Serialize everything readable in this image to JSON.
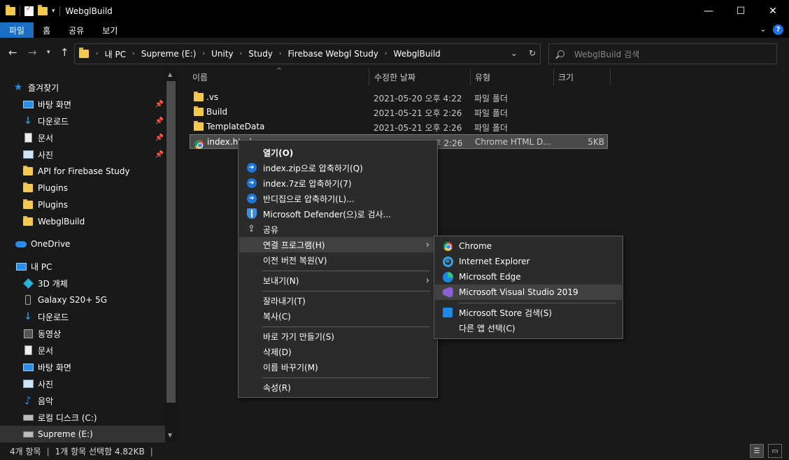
{
  "window": {
    "title": "WebglBuild",
    "minimize": "—",
    "maximize": "☐",
    "close": "✕"
  },
  "ribbon": {
    "tabs": [
      "파일",
      "홈",
      "공유",
      "보기"
    ]
  },
  "address": {
    "crumbs": [
      "내 PC",
      "Supreme (E:)",
      "Unity",
      "Study",
      "Firebase Webgl Study",
      "WebglBuild"
    ],
    "search_placeholder": "WebglBuild 검색"
  },
  "navpane": {
    "items": [
      {
        "label": "즐겨찾기",
        "icon": "star-icon",
        "pinned": false
      },
      {
        "label": "바탕 화면",
        "icon": "desktop-icon",
        "pinned": true
      },
      {
        "label": "다운로드",
        "icon": "download-icon",
        "pinned": true
      },
      {
        "label": "문서",
        "icon": "document-icon",
        "pinned": true
      },
      {
        "label": "사진",
        "icon": "pictures-icon",
        "pinned": true
      },
      {
        "label": "API for Firebase Study",
        "icon": "folder-icon",
        "pinned": false
      },
      {
        "label": "Plugins",
        "icon": "folder-icon",
        "pinned": false
      },
      {
        "label": "Plugins",
        "icon": "folder-icon",
        "pinned": false
      },
      {
        "label": "WebglBuild",
        "icon": "folder-icon",
        "pinned": false
      },
      {
        "label": "OneDrive",
        "icon": "onedrive-icon",
        "pinned": false
      },
      {
        "label": "내 PC",
        "icon": "pc-icon",
        "pinned": false
      },
      {
        "label": "3D 개체",
        "icon": "3d-objects-icon",
        "pinned": false
      },
      {
        "label": "Galaxy S20+ 5G",
        "icon": "phone-icon",
        "pinned": false
      },
      {
        "label": "다운로드",
        "icon": "download-icon",
        "pinned": false
      },
      {
        "label": "동영상",
        "icon": "video-icon",
        "pinned": false
      },
      {
        "label": "문서",
        "icon": "document-icon",
        "pinned": false
      },
      {
        "label": "바탕 화면",
        "icon": "desktop-icon",
        "pinned": false
      },
      {
        "label": "사진",
        "icon": "pictures-icon",
        "pinned": false
      },
      {
        "label": "음악",
        "icon": "music-icon",
        "pinned": false
      },
      {
        "label": "로컬 디스크 (C:)",
        "icon": "drive-icon",
        "pinned": false
      },
      {
        "label": "Supreme (E:)",
        "icon": "drive-icon",
        "pinned": false
      }
    ]
  },
  "filelist": {
    "columns": [
      "이름",
      "수정한 날짜",
      "유형",
      "크기"
    ],
    "rows": [
      {
        "name": ".vs",
        "date": "2021-05-20 오후 4:22",
        "type": "파일 폴더",
        "size": "",
        "icon": "folder-icon"
      },
      {
        "name": "Build",
        "date": "2021-05-21 오후 2:26",
        "type": "파일 폴더",
        "size": "",
        "icon": "folder-icon"
      },
      {
        "name": "TemplateData",
        "date": "2021-05-21 오후 2:26",
        "type": "파일 폴더",
        "size": "",
        "icon": "folder-icon"
      },
      {
        "name": "index.html",
        "date": "2021-05-21 오후 2:26",
        "type": "Chrome HTML D...",
        "size": "5KB",
        "icon": "chrome-icon"
      }
    ]
  },
  "context_menu": {
    "items": [
      {
        "label": "열기(O)",
        "bold": true
      },
      {
        "label": "index.zip으로 압축하기(Q)",
        "icon": "bandizip-icon"
      },
      {
        "label": "index.7z로 압축하기(7)",
        "icon": "bandizip-icon"
      },
      {
        "label": "반디집으로 압축하기(L)...",
        "icon": "bandizip-icon"
      },
      {
        "label": "Microsoft Defender(으)로 검사...",
        "icon": "defender-shield-icon"
      },
      {
        "label": "공유",
        "icon": "share-icon"
      },
      {
        "label": "연결 프로그램(H)",
        "submenu": true
      },
      {
        "label": "이전 버전 복원(V)"
      },
      {
        "label": "보내기(N)",
        "submenu": true
      },
      {
        "label": "잘라내기(T)"
      },
      {
        "label": "복사(C)"
      },
      {
        "label": "바로 가기 만들기(S)"
      },
      {
        "label": "삭제(D)"
      },
      {
        "label": "이름 바꾸기(M)"
      },
      {
        "label": "속성(R)"
      }
    ]
  },
  "open_with_menu": {
    "items": [
      {
        "label": "Chrome",
        "icon": "chrome-icon"
      },
      {
        "label": "Internet Explorer",
        "icon": "internet-explorer-icon"
      },
      {
        "label": "Microsoft Edge",
        "icon": "edge-icon"
      },
      {
        "label": "Microsoft Visual Studio 2019",
        "icon": "visual-studio-icon"
      },
      {
        "label": "Microsoft Store 검색(S)",
        "icon": "store-icon"
      },
      {
        "label": "다른 앱 선택(C)"
      }
    ]
  },
  "status": {
    "count": "4개 항목",
    "selected": "1개 항목 선택함 4.82KB"
  },
  "colors": {
    "accent": "#1a6fc4",
    "background": "#191919",
    "menu_bg": "#2b2b2b",
    "folder": "#f3c94e"
  }
}
